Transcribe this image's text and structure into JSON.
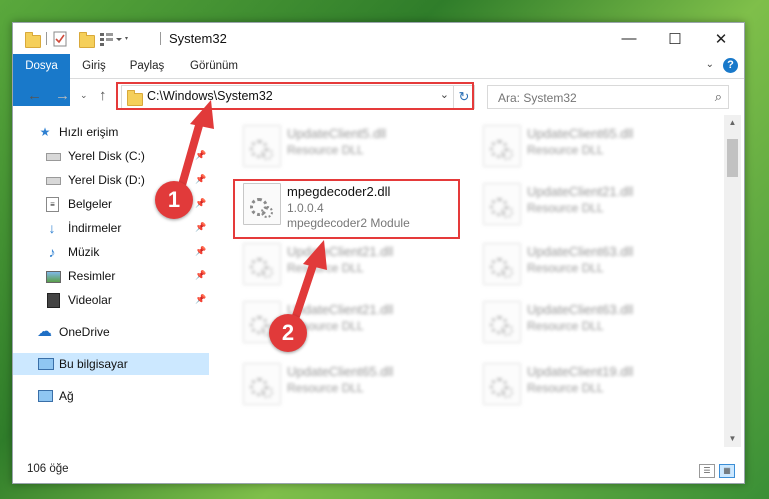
{
  "window": {
    "title": "System32"
  },
  "controls": {
    "minimize": "—",
    "maximize": "☐",
    "close": "✕"
  },
  "ribbon": {
    "tabs": [
      "Dosya",
      "Giriş",
      "Paylaş",
      "Görünüm"
    ],
    "help": "?"
  },
  "address": {
    "path": "C:\\Windows\\System32"
  },
  "search": {
    "placeholder": "Ara: System32"
  },
  "sidebar": {
    "items": [
      {
        "label": "Hızlı erişim",
        "icon": "star-icon"
      },
      {
        "label": "Yerel Disk (C:)",
        "icon": "drive-icon",
        "pinned": true
      },
      {
        "label": "Yerel Disk (D:)",
        "icon": "drive-icon",
        "pinned": true
      },
      {
        "label": "Belgeler",
        "icon": "documents-icon",
        "pinned": true
      },
      {
        "label": "İndirmeler",
        "icon": "download-icon",
        "pinned": true
      },
      {
        "label": "Müzik",
        "icon": "music-icon",
        "pinned": true
      },
      {
        "label": "Resimler",
        "icon": "pictures-icon",
        "pinned": true
      },
      {
        "label": "Videolar",
        "icon": "video-icon",
        "pinned": true
      },
      {
        "label": "OneDrive",
        "icon": "cloud-icon"
      },
      {
        "label": "Bu bilgisayar",
        "icon": "computer-icon",
        "selected": true
      },
      {
        "label": "Ağ",
        "icon": "network-icon"
      }
    ]
  },
  "files": {
    "left": [
      {
        "name": "UpdateClient5.dll",
        "type": "Resource DLL"
      },
      {
        "name": "mpegdecoder2.dll",
        "version": "1.0.0.4",
        "type": "mpegdecoder2 Module",
        "highlighted": true
      },
      {
        "name": "UpdateClient21.dll",
        "type": "Resource DLL"
      },
      {
        "name": "UpdateClient21.dll",
        "type": "Resource DLL"
      },
      {
        "name": "UpdateClient65.dll",
        "type": "Resource DLL"
      }
    ],
    "right": [
      {
        "name": "UpdateClient65.dll",
        "type": "Resource DLL"
      },
      {
        "name": "UpdateClient21.dll",
        "type": "Resource DLL"
      },
      {
        "name": "UpdateClient63.dll",
        "type": "Resource DLL"
      },
      {
        "name": "UpdateClient63.dll",
        "type": "Resource DLL"
      },
      {
        "name": "UpdateClient19.dll",
        "type": "Resource DLL"
      }
    ]
  },
  "status": {
    "count": "106 öğe"
  },
  "annotations": {
    "step1": "1",
    "step2": "2",
    "color": "#e13a3a"
  }
}
